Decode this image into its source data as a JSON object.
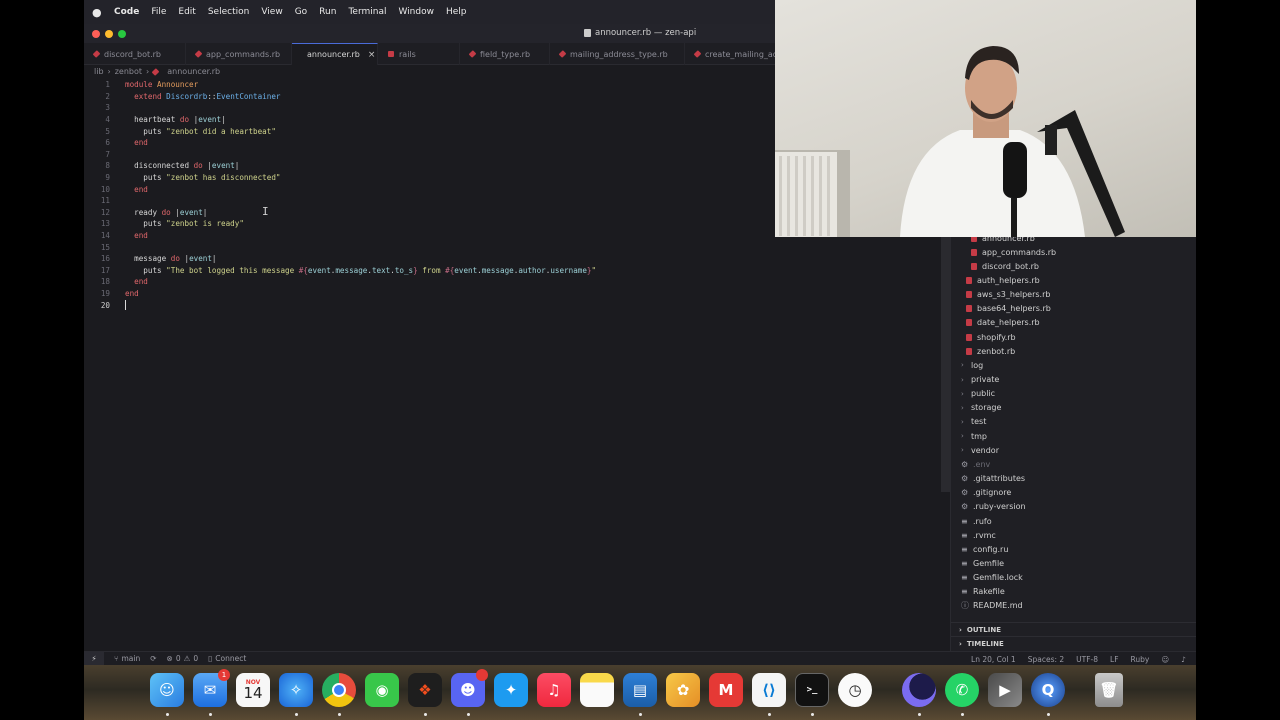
{
  "menubar": {
    "app_name": "Code",
    "items": [
      "File",
      "Edit",
      "Selection",
      "View",
      "Go",
      "Run",
      "Terminal",
      "Window",
      "Help"
    ]
  },
  "window": {
    "title": "announcer.rb — zen-api"
  },
  "tabs": [
    {
      "label": "discord_bot.rb",
      "active": false
    },
    {
      "label": "app_commands.rb",
      "active": false
    },
    {
      "label": "announcer.rb",
      "active": true
    },
    {
      "label": "rails",
      "active": false
    },
    {
      "label": "field_type.rb",
      "active": false
    },
    {
      "label": "mailing_address_type.rb",
      "active": false
    },
    {
      "label": "create_mailing_ad",
      "active": false
    }
  ],
  "breadcrumb": [
    "lib",
    "zenbot",
    "announcer.rb"
  ],
  "editor": {
    "line_numbers": [
      "1",
      "2",
      "3",
      "4",
      "5",
      "6",
      "7",
      "8",
      "9",
      "10",
      "11",
      "12",
      "13",
      "14",
      "15",
      "16",
      "17",
      "18",
      "19",
      "20"
    ],
    "current_line": "20"
  },
  "sidebar": {
    "files": [
      {
        "label": "announcer.rb",
        "type": "ruby",
        "indent": 2
      },
      {
        "label": "app_commands.rb",
        "type": "ruby",
        "indent": 2
      },
      {
        "label": "discord_bot.rb",
        "type": "ruby",
        "indent": 2
      },
      {
        "label": "auth_helpers.rb",
        "type": "ruby",
        "indent": 1
      },
      {
        "label": "aws_s3_helpers.rb",
        "type": "ruby",
        "indent": 1
      },
      {
        "label": "base64_helpers.rb",
        "type": "ruby",
        "indent": 1
      },
      {
        "label": "date_helpers.rb",
        "type": "ruby",
        "indent": 1
      },
      {
        "label": "shopify.rb",
        "type": "ruby",
        "indent": 1
      },
      {
        "label": "zenbot.rb",
        "type": "ruby",
        "indent": 1
      },
      {
        "label": "log",
        "type": "folder",
        "indent": 0
      },
      {
        "label": "private",
        "type": "folder",
        "indent": 0
      },
      {
        "label": "public",
        "type": "folder",
        "indent": 0
      },
      {
        "label": "storage",
        "type": "folder",
        "indent": 0
      },
      {
        "label": "test",
        "type": "folder",
        "indent": 0
      },
      {
        "label": "tmp",
        "type": "folder",
        "indent": 0
      },
      {
        "label": "vendor",
        "type": "folder",
        "indent": 0
      },
      {
        "label": ".env",
        "type": "gear-dim",
        "indent": 0
      },
      {
        "label": ".gitattributes",
        "type": "gear",
        "indent": 0
      },
      {
        "label": ".gitignore",
        "type": "gear",
        "indent": 0
      },
      {
        "label": ".ruby-version",
        "type": "gear",
        "indent": 0
      },
      {
        "label": ".rufo",
        "type": "lines",
        "indent": 0
      },
      {
        "label": ".rvmc",
        "type": "lines",
        "indent": 0
      },
      {
        "label": "config.ru",
        "type": "lines",
        "indent": 0
      },
      {
        "label": "Gemfile",
        "type": "lines",
        "indent": 0
      },
      {
        "label": "Gemfile.lock",
        "type": "lines",
        "indent": 0
      },
      {
        "label": "Rakefile",
        "type": "lines",
        "indent": 0
      },
      {
        "label": "README.md",
        "type": "info",
        "indent": 0
      }
    ],
    "outline_label": "OUTLINE",
    "timeline_label": "TIMELINE"
  },
  "statusbar": {
    "branch": "main",
    "errors": "0",
    "warnings": "0",
    "connect": "Connect",
    "position": "Ln 20, Col 1",
    "spaces": "Spaces: 2",
    "encoding": "UTF-8",
    "eol": "LF",
    "language": "Ruby"
  },
  "dock": {
    "mail_badge": "1",
    "calendar_month": "NOV",
    "calendar_day": "14"
  },
  "colors": {
    "keyword": "#e0676b",
    "constant": "#e39c5e",
    "class": "#6cb0e8",
    "string": "#cfd38c",
    "ruby_icon": "#c53b46",
    "active_tab_accent": "#4a6bd8"
  }
}
